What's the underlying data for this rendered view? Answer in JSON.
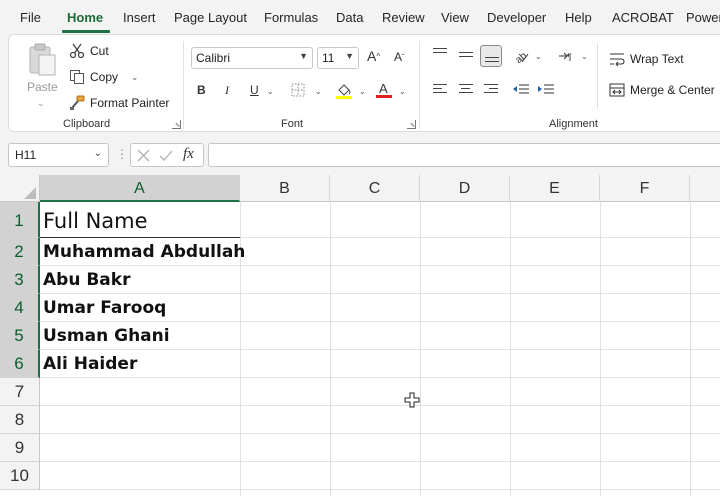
{
  "tabs": [
    "File",
    "Home",
    "Insert",
    "Page Layout",
    "Formulas",
    "Data",
    "Review",
    "View",
    "Developer",
    "Help",
    "ACROBAT",
    "Power"
  ],
  "active_tab": "Home",
  "ribbon": {
    "clipboard": {
      "paste_label": "Paste",
      "cut_label": "Cut",
      "copy_label": "Copy",
      "format_painter_label": "Format Painter",
      "group_label": "Clipboard"
    },
    "font": {
      "font_name": "Calibri",
      "font_size": "11",
      "bold": "B",
      "italic": "I",
      "underline": "U",
      "group_label": "Font"
    },
    "alignment": {
      "wrap_text_label": "Wrap Text",
      "merge_center_label": "Merge & Center",
      "group_label": "Alignment"
    }
  },
  "formula_bar": {
    "name_box": "H11",
    "fx_label": "fx",
    "formula_value": ""
  },
  "columns": [
    "A",
    "B",
    "C",
    "D",
    "E",
    "F"
  ],
  "selected_column": "A",
  "rows": [
    "1",
    "2",
    "3",
    "4",
    "5",
    "6",
    "7",
    "8",
    "9",
    "10"
  ],
  "selected_rows": [
    "1",
    "2",
    "3",
    "4",
    "5",
    "6"
  ],
  "cells": {
    "A1": "Full Name",
    "A2": "Muhammad Abdullah",
    "A3": "Abu Bakr",
    "A4": "Umar Farooq",
    "A5": "Usman Ghani",
    "A6": "Ali Haider"
  },
  "colors": {
    "accent": "#1e7145",
    "active_tab_text": "#1e6b38",
    "fill_highlight": "#ffff00",
    "font_color_red": "#e02020"
  },
  "icons": {
    "paste": "paste-icon",
    "cut": "scissors-icon",
    "copy": "copy-icon",
    "format_painter": "brush-icon",
    "grow_font": "font-grow-icon",
    "shrink_font": "font-shrink-icon",
    "borders": "borders-icon",
    "fill_color": "paint-bucket-icon",
    "font_color": "font-color-icon",
    "wrap_text": "wrap-text-icon",
    "merge_center": "merge-icon",
    "cursor": "crosshair-cursor-icon"
  }
}
